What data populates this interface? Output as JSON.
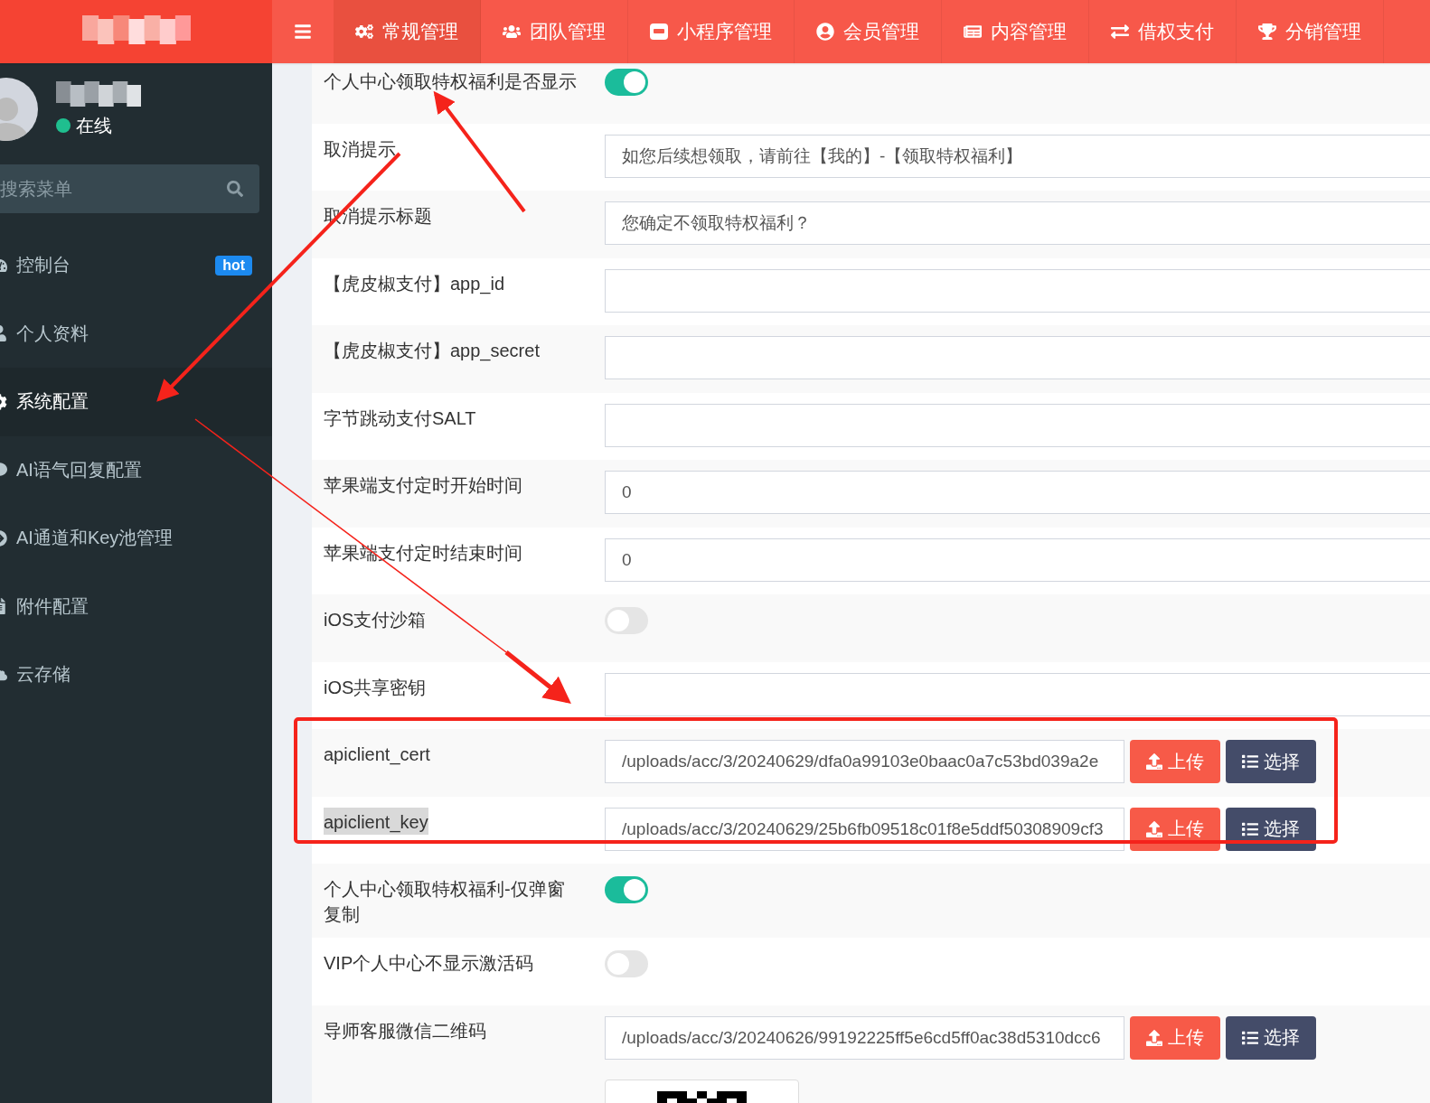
{
  "header": {
    "nav": [
      {
        "label": "常规管理",
        "selected": true
      },
      {
        "label": "团队管理",
        "selected": false
      },
      {
        "label": "小程序管理",
        "selected": false
      },
      {
        "label": "会员管理",
        "selected": false
      },
      {
        "label": "内容管理",
        "selected": false
      },
      {
        "label": "借权支付",
        "selected": false
      },
      {
        "label": "分销管理",
        "selected": false
      }
    ]
  },
  "sidebar": {
    "user": {
      "status": "在线"
    },
    "search": {
      "placeholder": "搜索菜单"
    },
    "items": [
      {
        "label": "控制台",
        "badge": "hot",
        "selected": false
      },
      {
        "label": "个人资料",
        "selected": false
      },
      {
        "label": "系统配置",
        "selected": true
      },
      {
        "label": "AI语气回复配置",
        "selected": false
      },
      {
        "label": "AI通道和Key池管理",
        "selected": false
      },
      {
        "label": "附件配置",
        "selected": false
      },
      {
        "label": "云存储",
        "selected": false
      }
    ]
  },
  "form": {
    "rows": [
      {
        "kind": "toggle",
        "label": "个人中心领取特权福利是否显示",
        "on": true,
        "highlighted": false
      },
      {
        "kind": "text",
        "label": "取消提示",
        "value": "如您后续想领取，请前往【我的】-【领取特权福利】",
        "highlighted": false
      },
      {
        "kind": "text",
        "label": "取消提示标题",
        "value": "您确定不领取特权福利？",
        "highlighted": false
      },
      {
        "kind": "text",
        "label": "【虎皮椒支付】app_id",
        "highlighted": false
      },
      {
        "kind": "text",
        "label": "【虎皮椒支付】app_secret",
        "highlighted": false
      },
      {
        "kind": "text",
        "label": "字节跳动支付SALT",
        "highlighted": false
      },
      {
        "kind": "text",
        "label": "苹果端支付定时开始时间",
        "value": "0",
        "highlighted": false
      },
      {
        "kind": "text",
        "label": "苹果端支付定时结束时间",
        "value": "0",
        "highlighted": false
      },
      {
        "kind": "toggle",
        "label": "iOS支付沙箱",
        "on": false,
        "highlighted": false
      },
      {
        "kind": "text",
        "label": "iOS共享密钥",
        "highlighted": false
      },
      {
        "kind": "file",
        "label": "apiclient_cert",
        "value": "/uploads/acc/3/20240629/dfa0a99103e0baac0a7c53bd039a2e",
        "upload": "上传",
        "choose": "选择",
        "highlighted": false
      },
      {
        "kind": "file",
        "label": "apiclient_key",
        "value": "/uploads/acc/3/20240629/25b6fb09518c01f8e5ddf50308909cf3",
        "upload": "上传",
        "choose": "选择",
        "highlighted": true
      },
      {
        "kind": "toggle",
        "label": "个人中心领取特权福利-仅弹窗复制",
        "on": true,
        "highlighted": false
      },
      {
        "kind": "toggle",
        "label": "VIP个人中心不显示激活码",
        "on": false,
        "highlighted": false
      },
      {
        "kind": "image",
        "label": "导师客服微信二维码",
        "value": "/uploads/acc/3/20240626/99192225ff5e6cd5ff0ac38d5310dcc6",
        "upload": "上传",
        "choose": "选择",
        "highlighted": false
      }
    ]
  }
}
